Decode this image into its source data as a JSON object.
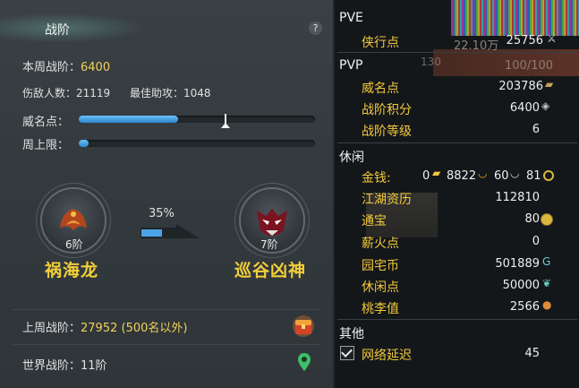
{
  "left": {
    "title": "战阶",
    "help": "?",
    "weekly_label": "本周战阶：",
    "weekly_value": "6400",
    "kills_label": "伤敌人数：21119",
    "assist_label": "最佳助攻：1048",
    "prestige_label": "威名点：",
    "prestige_progress": 0.42,
    "weekly_cap_label": "周上限：",
    "weekly_cap_progress": 0.04,
    "progress_percent": "35%",
    "progress_fraction": 0.35,
    "current_rank": {
      "level": "6阶",
      "name": "祸海龙"
    },
    "next_rank": {
      "level": "7阶",
      "name": "巡谷凶神"
    },
    "last_week_label": "上周战阶：",
    "last_week_value": "27952 (500名以外)",
    "world_label": "世界战阶：11阶"
  },
  "right": {
    "pve_title": "PVE",
    "pvp_title": "PVP",
    "leisure_title": "休闲",
    "other_title": "其他",
    "bg_text_a": "22.10万",
    "bg_text_b": "130",
    "bg_text_c": "100/100",
    "rows": {
      "xiaxing_label": "侠行点",
      "xiaxing_value": "25756",
      "weiming_label": "威名点",
      "weiming_value": "203786",
      "zhanjie_jifen_label": "战阶积分",
      "zhanjie_jifen_value": "6400",
      "zhanjie_dengji_label": "战阶等级",
      "zhanjie_dengji_value": "6",
      "money_label": "金钱:",
      "money_a": "0",
      "money_b": "8822",
      "money_c": "60",
      "money_d": "81",
      "jianghu_label": "江湖资历",
      "jianghu_value": "112810",
      "tongbao_label": "通宝",
      "tongbao_value": "80",
      "xinhuo_label": "薪火点",
      "xinhuo_value": "0",
      "yuanzhai_label": "园宅币",
      "yuanzhai_value": "501889",
      "xiuxian_label": "休闲点",
      "xiuxian_value": "50000",
      "taoli_label": "桃李值",
      "taoli_value": "2566",
      "latency_label": "网络延迟",
      "latency_value": "45"
    }
  },
  "colors": {
    "gold": "#f2c93a",
    "rank_name": "#f3cf3a",
    "bar": "#2d86d0"
  }
}
